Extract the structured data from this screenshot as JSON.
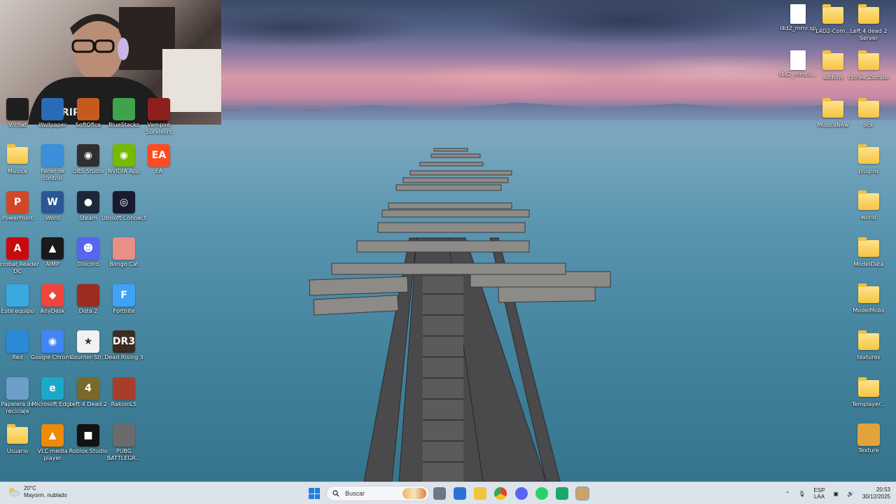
{
  "desktop": {
    "icons_left": [
      {
        "label": "Vrchat",
        "icon": "vrchat-icon"
      },
      {
        "label": "Wallpaper",
        "icon": "wallpaper-icon"
      },
      {
        "label": "SoftOfice",
        "icon": "office-icon"
      },
      {
        "label": "BlueStacks",
        "icon": "bluestacks-icon"
      },
      {
        "label": "Vampire Survivors",
        "icon": "vampire-survivors-icon"
      },
      {
        "label": "Musica",
        "icon": "folder-icon"
      },
      {
        "label": "Panel de control",
        "icon": "control-panel-icon"
      },
      {
        "label": "OBS Studio",
        "icon": "obs-icon"
      },
      {
        "label": "NVIDIA App",
        "icon": "nvidia-icon"
      },
      {
        "label": "EA",
        "icon": "ea-icon"
      },
      {
        "label": "PowerPoint",
        "icon": "powerpoint-icon"
      },
      {
        "label": "Word",
        "icon": "word-icon"
      },
      {
        "label": "Steam",
        "icon": "steam-icon"
      },
      {
        "label": "Ubisoft Connect",
        "icon": "ubisoft-icon"
      },
      {
        "label": "Acrobat Reader DC",
        "icon": "acrobat-icon"
      },
      {
        "label": "AIMP",
        "icon": "aimp-icon"
      },
      {
        "label": "Discord",
        "icon": "discord-icon"
      },
      {
        "label": "Bongo Cat",
        "icon": "bongo-cat-icon"
      },
      {
        "label": "Este equipo",
        "icon": "this-pc-icon"
      },
      {
        "label": "AnyDesk",
        "icon": "anydesk-icon"
      },
      {
        "label": "Dota 2",
        "icon": "dota2-icon"
      },
      {
        "label": "Fortnite",
        "icon": "fortnite-icon"
      },
      {
        "label": "Red",
        "icon": "network-icon"
      },
      {
        "label": "Google Chrome",
        "icon": "chrome-icon"
      },
      {
        "label": "Counter-Str...",
        "icon": "counter-strike-icon"
      },
      {
        "label": "Dead Rising 3",
        "icon": "dead-rising-icon"
      },
      {
        "label": "Papelera de reciclaje",
        "icon": "recycle-bin-icon"
      },
      {
        "label": "Microsoft Edge",
        "icon": "edge-icon"
      },
      {
        "label": "Left 4 Dead 2",
        "icon": "left4dead2-icon"
      },
      {
        "label": "RakionLS",
        "icon": "rakion-icon"
      },
      {
        "label": "Usuario",
        "icon": "folder-icon"
      },
      {
        "label": "VLC media player",
        "icon": "vlc-icon"
      },
      {
        "label": "Roblox Studio",
        "icon": "roblox-studio-icon"
      },
      {
        "label": "PUBG BATTLEGR...",
        "icon": "pubg-icon"
      }
    ],
    "icons_right": [
      {
        "label": "l4d2_mmr.sp",
        "icon": "file-icon"
      },
      {
        "label": "L4D2-Com...",
        "icon": "folder-icon"
      },
      {
        "label": "Left 4 dead 2 Server",
        "icon": "folder-icon"
      },
      {
        "label": "l4d2_mmr.s...",
        "icon": "file-icon"
      },
      {
        "label": "addons",
        "icon": "folder-icon"
      },
      {
        "label": "cstrike Zombie",
        "icon": "folder-icon"
      },
      {
        "label": "MusicaNew",
        "icon": "folder-icon"
      },
      {
        "label": "sck",
        "icon": "folder-icon"
      },
      {
        "label": "plugins",
        "icon": "folder-icon"
      },
      {
        "label": "world",
        "icon": "folder-icon"
      },
      {
        "label": "ModelData",
        "icon": "folder-icon"
      },
      {
        "label": "ModelMobs",
        "icon": "folder-icon"
      },
      {
        "label": "textures",
        "icon": "folder-icon"
      },
      {
        "label": "Templayer...",
        "icon": "folder-icon"
      },
      {
        "label": "Texture",
        "icon": "texture-icon"
      }
    ]
  },
  "taskbar": {
    "weather_temp": "20°C",
    "weather_desc": "Mayorm. nublado",
    "search_placeholder": "Buscar",
    "apps": [
      "file-explorer-icon",
      "store-icon",
      "folder-icon",
      "chrome-icon",
      "discord-icon",
      "whatsapp-icon",
      "android-icon",
      "sketch-icon"
    ],
    "lang_top": "ESP",
    "lang_bottom": "LAA",
    "time": "20:53",
    "date": "30/12/2025"
  }
}
